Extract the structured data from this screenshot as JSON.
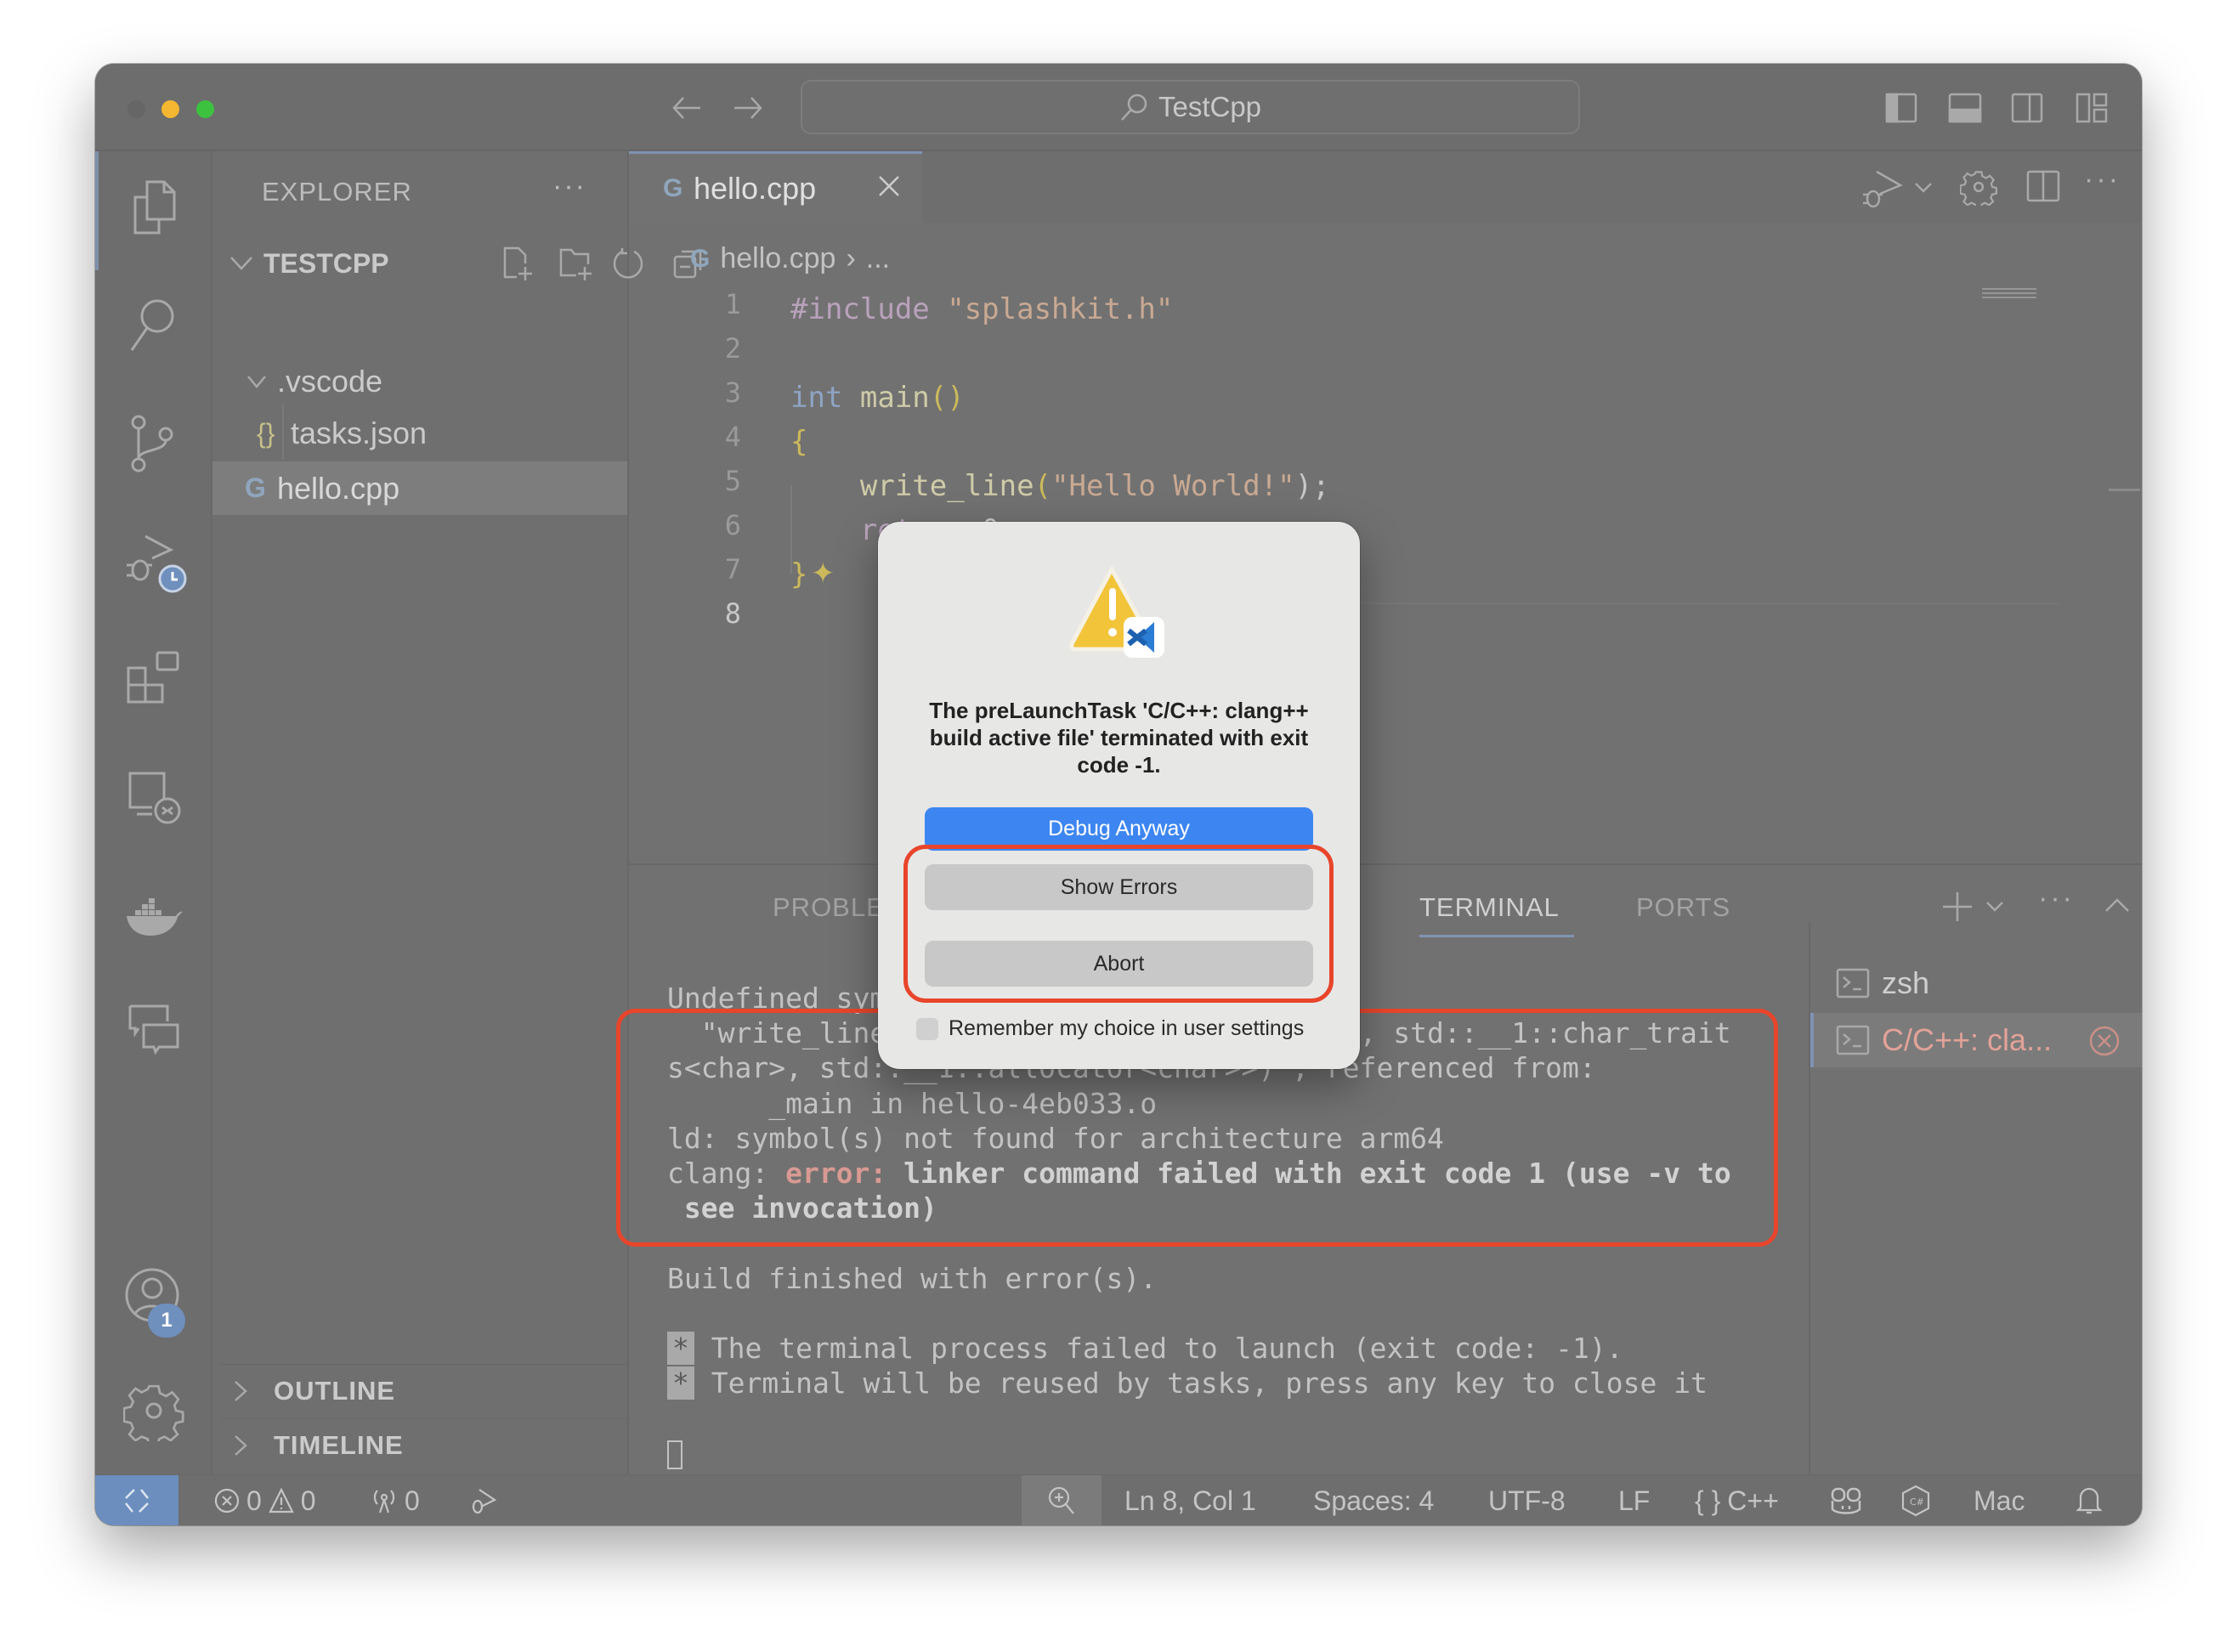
{
  "window": {
    "title": "TestCpp",
    "traffic_lights": [
      "#666666",
      "#f5b731",
      "#3cc23f"
    ]
  },
  "titlebar": {
    "search_icon": "search-icon",
    "layout_icons": [
      "toggle-primary-sidebar-icon",
      "toggle-panel-icon",
      "toggle-secondary-sidebar-icon",
      "customize-layout-icon"
    ]
  },
  "activity_bar": {
    "items": [
      "explorer",
      "search",
      "source-control",
      "run-and-debug",
      "extensions",
      "remote-explorer",
      "docker",
      "chat"
    ],
    "accounts_badge": "1",
    "accent": "#6f8fbd"
  },
  "sidebar": {
    "title": "EXPLORER",
    "more": "···",
    "folder": "TESTCPP",
    "tree": [
      {
        "label": ".vscode",
        "type": "folder"
      },
      {
        "label": "tasks.json",
        "icon": "{}"
      },
      {
        "label": "hello.cpp",
        "selected": true
      }
    ],
    "sections": [
      "OUTLINE",
      "TIMELINE"
    ]
  },
  "editor": {
    "tab": {
      "label": "hello.cpp"
    },
    "breadcrumb": {
      "file": "hello.cpp",
      "sep": "›",
      "rest": "..."
    },
    "lines": [
      {
        "n": "1",
        "tokens": [
          "#include",
          " \"splashkit.h\""
        ]
      },
      {
        "n": "2",
        "tokens": []
      },
      {
        "n": "3",
        "tokens": [
          "int",
          " main",
          "()"
        ]
      },
      {
        "n": "4",
        "tokens": [
          "{"
        ]
      },
      {
        "n": "5",
        "tokens": [
          "    write_line",
          "(",
          "\"Hello World!\"",
          ");"
        ]
      },
      {
        "n": "6",
        "tokens": [
          "    return",
          " 0;"
        ]
      },
      {
        "n": "7",
        "tokens": [
          "}"
        ]
      },
      {
        "n": "8",
        "tokens": []
      }
    ]
  },
  "panel": {
    "tabs": [
      "PROBLEMS",
      "TERMINAL",
      "PORTS"
    ],
    "active_tab": "TERMINAL",
    "terminal_lines": [
      "Undefined symbols for architecture arm64:",
      "  \"write_line(std::__1::basic_string<char, std::__1::char_trait",
      "s<char>, std::__1::allocator<char>>)\", referenced from:",
      "      _main in hello-4eb033.o",
      "ld: symbol(s) not found for architecture arm64"
    ],
    "clang_prefix": "clang: ",
    "clang_error": "error:",
    "clang_msg": " linker command failed with exit code 1 (use -v to",
    "clang_msg2": " see invocation)",
    "build_finished": "Build finished with error(s).",
    "star": "*",
    "notice_1": " The terminal process failed to launch (exit code: -1).",
    "notice_2": " Terminal will be reused by tasks, press any key to close it",
    "terminals": [
      {
        "label": "zsh"
      },
      {
        "label": "C/C++: cla...",
        "error": true
      }
    ],
    "error_color": "#e89a8e"
  },
  "status_bar": {
    "errors": "0",
    "warnings": "0",
    "ports": "0",
    "position": "Ln 8, Col 1",
    "spaces": "Spaces: 4",
    "encoding": "UTF-8",
    "eol": "LF",
    "language_icon": "{ }",
    "language": "C++",
    "platform": "Mac",
    "remote_color": "#6c8ebf"
  },
  "dialog": {
    "message": "The preLaunchTask 'C/C++: clang++ build active file' terminated with exit code -1.",
    "buttons": {
      "debug_anyway": "Debug Anyway",
      "show_errors": "Show Errors",
      "abort": "Abort"
    },
    "remember_label": "Remember my choice in user settings",
    "remember_checked": false,
    "primary_color": "#3d86f1"
  },
  "annotation_color": "#e8452b"
}
